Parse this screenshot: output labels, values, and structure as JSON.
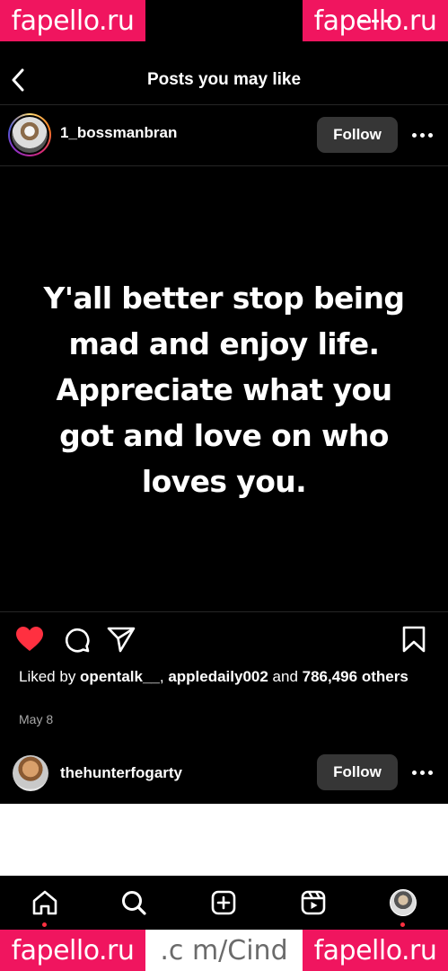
{
  "watermark": {
    "brand": "fapello.ru",
    "bottom_center": ".c m/Cind"
  },
  "header": {
    "title": "Posts you may like",
    "back_icon": "chevron-left-icon"
  },
  "post1": {
    "username": "1_bossmanbran",
    "follow_label": "Follow",
    "image_text": "Y'all better stop being mad and enjoy life. Appreciate what you got and love on who loves you.",
    "liked_by_prefix": "Liked by ",
    "liked_by_user1": "opentalk__",
    "liked_by_sep": ", ",
    "liked_by_user2": "appledaily002",
    "liked_by_and": " and ",
    "liked_by_count": "786,496 others",
    "date": "May 8",
    "liked": true,
    "icons": [
      "heart-icon",
      "comment-icon",
      "share-icon",
      "bookmark-icon"
    ]
  },
  "post2": {
    "username": "thehunterfogarty",
    "follow_label": "Follow"
  },
  "colors": {
    "background": "#000000",
    "heart": "#ff3040",
    "button": "#363636",
    "watermark": "#f0155f"
  },
  "bottom_nav": {
    "items": [
      "home-icon",
      "search-icon",
      "create-icon",
      "reels-icon",
      "profile-avatar"
    ]
  }
}
